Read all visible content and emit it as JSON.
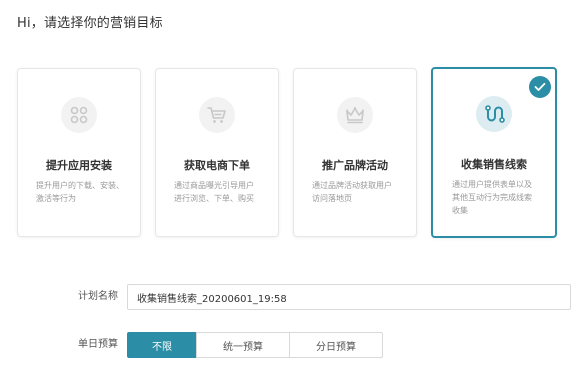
{
  "page": {
    "title": "Hi，请选择你的营销目标"
  },
  "colors": {
    "accent": "#2b8ea6",
    "accent_light": "#dcecf0",
    "muted_icon": "#cccccc",
    "muted_circle": "#f2f2f2"
  },
  "goals": {
    "selected_index": 3,
    "items": [
      {
        "icon": "app-grid-icon",
        "title": "提升应用安装",
        "desc": "提升用户的下载、安装、激活等行为"
      },
      {
        "icon": "shopping-cart-icon",
        "title": "获取电商下单",
        "desc": "通过商品曝光引导用户进行浏览、下单、购买"
      },
      {
        "icon": "crown-icon",
        "title": "推广品牌活动",
        "desc": "通过品牌活动获取用户访问落地页"
      },
      {
        "icon": "route-path-icon",
        "title": "收集销售线索",
        "desc": "通过用户提供表单以及其他互动行为完成线索收集"
      }
    ]
  },
  "form": {
    "plan_name_label": "计划名称",
    "plan_name_value": "收集销售线索_20200601_19:58",
    "budget_label": "单日预算",
    "budget_options": [
      "不限",
      "统一预算",
      "分日预算"
    ],
    "budget_selected_index": 0
  }
}
